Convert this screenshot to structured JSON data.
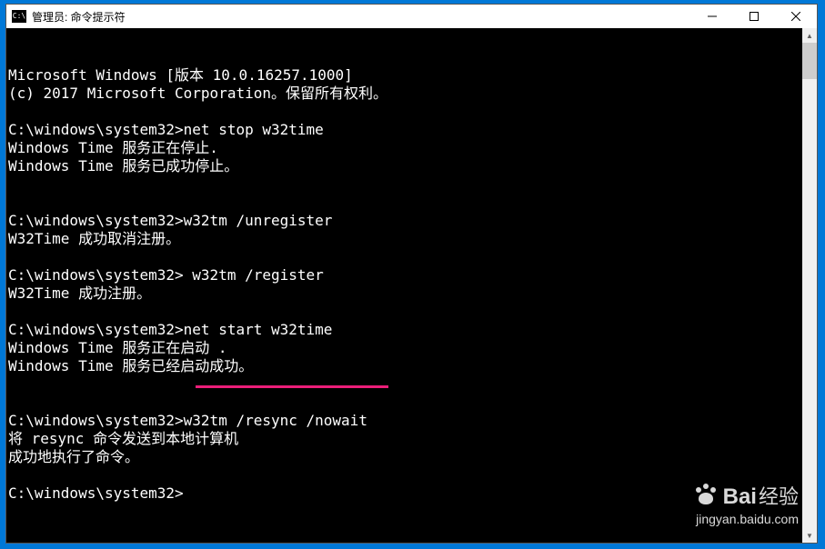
{
  "window": {
    "title": "管理员: 命令提示符"
  },
  "terminal": {
    "lines": [
      "Microsoft Windows [版本 10.0.16257.1000]",
      "(c) 2017 Microsoft Corporation。保留所有权利。",
      "",
      "C:\\windows\\system32>net stop w32time",
      "Windows Time 服务正在停止.",
      "Windows Time 服务已成功停止。",
      "",
      "",
      "C:\\windows\\system32>w32tm /unregister",
      "W32Time 成功取消注册。",
      "",
      "C:\\windows\\system32> w32tm /register",
      "W32Time 成功注册。",
      "",
      "C:\\windows\\system32>net start w32time",
      "Windows Time 服务正在启动 .",
      "Windows Time 服务已经启动成功。",
      "",
      "",
      "C:\\windows\\system32>w32tm /resync /nowait",
      "将 resync 命令发送到本地计算机",
      "成功地执行了命令。",
      "",
      "C:\\windows\\system32>"
    ],
    "highlighted_command": "w32tm /resync /nowait"
  },
  "watermark": {
    "brand_prefix": "Bai",
    "brand_suffix": "经验",
    "url": "jingyan.baidu.com"
  }
}
